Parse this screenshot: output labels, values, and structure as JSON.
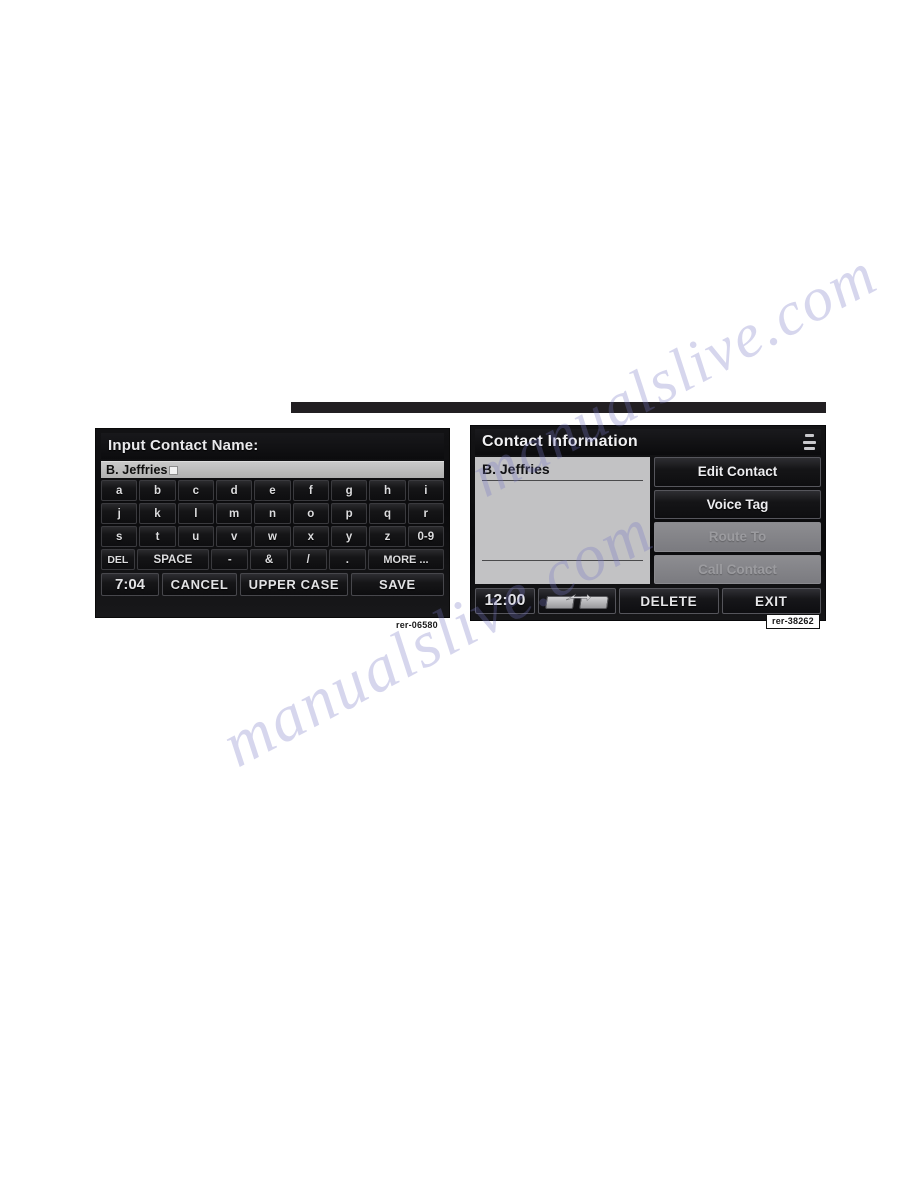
{
  "page": {
    "background_color": "#ffffff",
    "rule_bar_color": "#221f22"
  },
  "watermark": {
    "line1": "manualslive.com",
    "line2": "manualslive.com"
  },
  "left_screen": {
    "figure_code": "rer-06580",
    "title": "Input Contact Name:",
    "input_field": {
      "value": "B. Jeffries",
      "caret": "block-cursor"
    },
    "keyboard_rows": [
      [
        "a",
        "b",
        "c",
        "d",
        "e",
        "f",
        "g",
        "h",
        "i"
      ],
      [
        "j",
        "k",
        "l",
        "m",
        "n",
        "o",
        "p",
        "q",
        "r"
      ],
      [
        "s",
        "t",
        "u",
        "v",
        "w",
        "x",
        "y",
        "z",
        "0-9"
      ]
    ],
    "function_row": [
      "DEL",
      "SPACE",
      "-",
      "&",
      "/",
      ".",
      "MORE ..."
    ],
    "bottom_bar": {
      "clock": "7:04",
      "cancel_label": "CANCEL",
      "upper_case_label": "UPPER CASE",
      "save_label": "SAVE"
    }
  },
  "right_screen": {
    "figure_code": "rer-38262",
    "title": "Contact Information",
    "menu_icon": "stacked-bars-icon",
    "contact_list": [
      "B. Jeffries"
    ],
    "action_buttons": [
      {
        "label": "Edit Contact",
        "enabled": true
      },
      {
        "label": "Voice Tag",
        "enabled": true
      },
      {
        "label": "Route To",
        "enabled": false
      },
      {
        "label": "Call Contact",
        "enabled": false
      }
    ],
    "bottom_bar": {
      "clock": "12:00",
      "transfer_icon": "folder-transfer-icon",
      "delete_label": "DELETE",
      "exit_label": "EXIT"
    }
  }
}
